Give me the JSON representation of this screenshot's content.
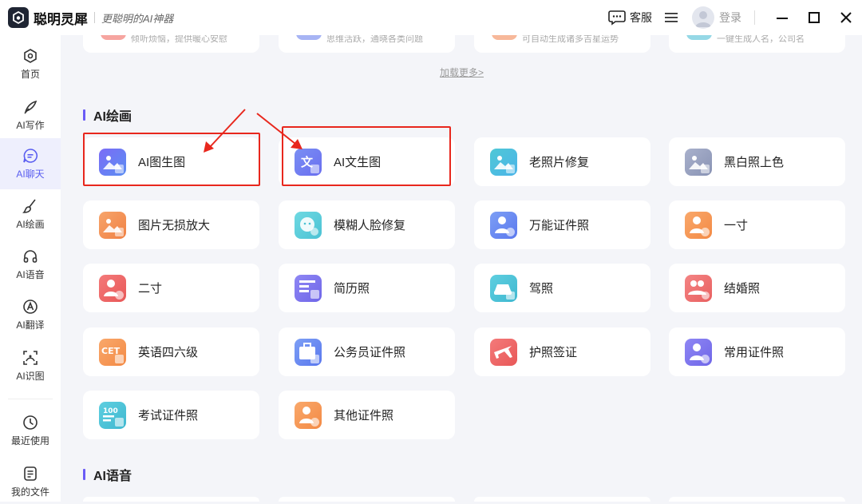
{
  "app": {
    "name": "聪明灵犀",
    "slogan": "更聪明的AI神器"
  },
  "header": {
    "customer_service": "客服",
    "login": "登录"
  },
  "sidebar": {
    "items": [
      {
        "label": "首页",
        "icon": "home-icon"
      },
      {
        "label": "AI写作",
        "icon": "pen-icon"
      },
      {
        "label": "AI聊天",
        "icon": "chat-icon",
        "active": true
      },
      {
        "label": "AI绘画",
        "icon": "brush-icon"
      },
      {
        "label": "AI语音",
        "icon": "headphones-icon"
      },
      {
        "label": "AI翻译",
        "icon": "translate-icon"
      },
      {
        "label": "AI识图",
        "icon": "scan-icon"
      },
      {
        "label": "最近使用",
        "icon": "history-icon"
      },
      {
        "label": "我的文件",
        "icon": "file-icon"
      }
    ]
  },
  "top_cards": [
    {
      "desc": "倾听烦恼，提供暖心安慰"
    },
    {
      "desc": "思维活跃，通晓各类问题"
    },
    {
      "desc": "可自动生成诸多吉星运势"
    },
    {
      "desc": "一键生成人名，公司名"
    }
  ],
  "load_more": "加载更多>",
  "sections": {
    "painting": {
      "title": "AI绘画",
      "tiles": [
        {
          "label": "AI图生图",
          "icon": "image-to-image-icon"
        },
        {
          "label": "AI文生图",
          "icon": "text-to-image-icon"
        },
        {
          "label": "老照片修复",
          "icon": "old-photo-restore-icon"
        },
        {
          "label": "黑白照上色",
          "icon": "colorize-icon"
        },
        {
          "label": "图片无损放大",
          "icon": "image-upscale-icon"
        },
        {
          "label": "模糊人脸修复",
          "icon": "face-restore-icon"
        },
        {
          "label": "万能证件照",
          "icon": "id-photo-universal-icon"
        },
        {
          "label": "一寸",
          "icon": "one-inch-photo-icon"
        },
        {
          "label": "二寸",
          "icon": "two-inch-photo-icon"
        },
        {
          "label": "简历照",
          "icon": "resume-photo-icon"
        },
        {
          "label": "驾照",
          "icon": "driver-license-icon"
        },
        {
          "label": "结婚照",
          "icon": "wedding-photo-icon"
        },
        {
          "label": "英语四六级",
          "icon": "cet-photo-icon"
        },
        {
          "label": "公务员证件照",
          "icon": "civil-servant-photo-icon"
        },
        {
          "label": "护照签证",
          "icon": "passport-visa-icon"
        },
        {
          "label": "常用证件照",
          "icon": "common-id-photo-icon"
        },
        {
          "label": "考试证件照",
          "icon": "exam-photo-icon"
        },
        {
          "label": "其他证件照",
          "icon": "other-id-photo-icon"
        }
      ]
    },
    "voice": {
      "title": "AI语音"
    }
  },
  "colors": {
    "accent": "#6b5cf6",
    "highlight": "#e8271d",
    "sidebar_active_bg": "#eeeffd"
  }
}
